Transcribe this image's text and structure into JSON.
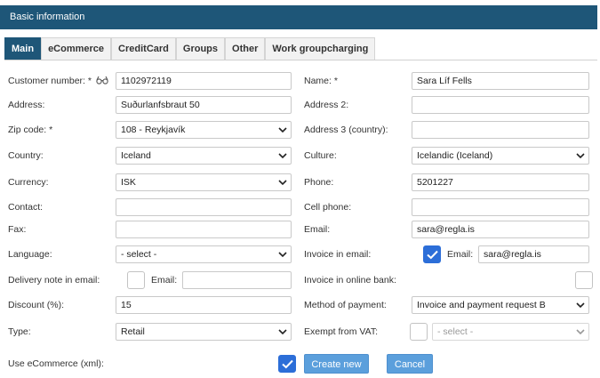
{
  "header": {
    "title": "Basic information"
  },
  "tabs": [
    "Main",
    "eCommerce",
    "CreditCard",
    "Groups",
    "Other",
    "Work groupcharging"
  ],
  "form": {
    "customer_number": {
      "label": "Customer number: *",
      "value": "1102972119"
    },
    "name": {
      "label": "Name: *",
      "value": "Sara Líf Fells"
    },
    "address": {
      "label": "Address:",
      "value": "Suðurlanfsbraut 50"
    },
    "address2": {
      "label": "Address 2:",
      "value": ""
    },
    "zip": {
      "label": "Zip code: *",
      "value": "108 - Reykjavík"
    },
    "address3": {
      "label": "Address 3 (country):",
      "value": ""
    },
    "country": {
      "label": "Country:",
      "value": "Iceland"
    },
    "culture": {
      "label": "Culture:",
      "value": "Icelandic (Iceland)"
    },
    "currency": {
      "label": "Currency:",
      "value": "ISK"
    },
    "phone": {
      "label": "Phone:",
      "value": "5201227"
    },
    "contact": {
      "label": "Contact:",
      "value": ""
    },
    "cell_phone": {
      "label": "Cell phone:",
      "value": ""
    },
    "fax": {
      "label": "Fax:",
      "value": ""
    },
    "email": {
      "label": "Email:",
      "value": "sara@regla.is"
    },
    "language": {
      "label": "Language:",
      "value": "- select -"
    },
    "invoice_in_email": {
      "label": "Invoice in email:",
      "checked": true,
      "email_label": "Email:",
      "email_value": "sara@regla.is"
    },
    "delivery_note": {
      "label": "Delivery note in email:",
      "checked": false,
      "email_label": "Email:",
      "email_value": ""
    },
    "invoice_online_bank": {
      "label": "Invoice in online bank:",
      "checked": false
    },
    "discount": {
      "label": "Discount (%):",
      "value": "15"
    },
    "method_of_payment": {
      "label": "Method of payment:",
      "value": "Invoice and payment request B"
    },
    "type": {
      "label": "Type:",
      "value": "Retail"
    },
    "exempt_vat": {
      "label": "Exempt from VAT:",
      "checked": false,
      "select_value": "- select -"
    },
    "use_ecommerce": {
      "label": "Use eCommerce (xml):",
      "checked": true
    }
  },
  "actions": {
    "create_label": "Create new",
    "cancel_label": "Cancel"
  },
  "colors": {
    "header_bg": "#1e5678",
    "checkbox_blue": "#2c6ed8",
    "button_blue": "#5b9fdc"
  }
}
